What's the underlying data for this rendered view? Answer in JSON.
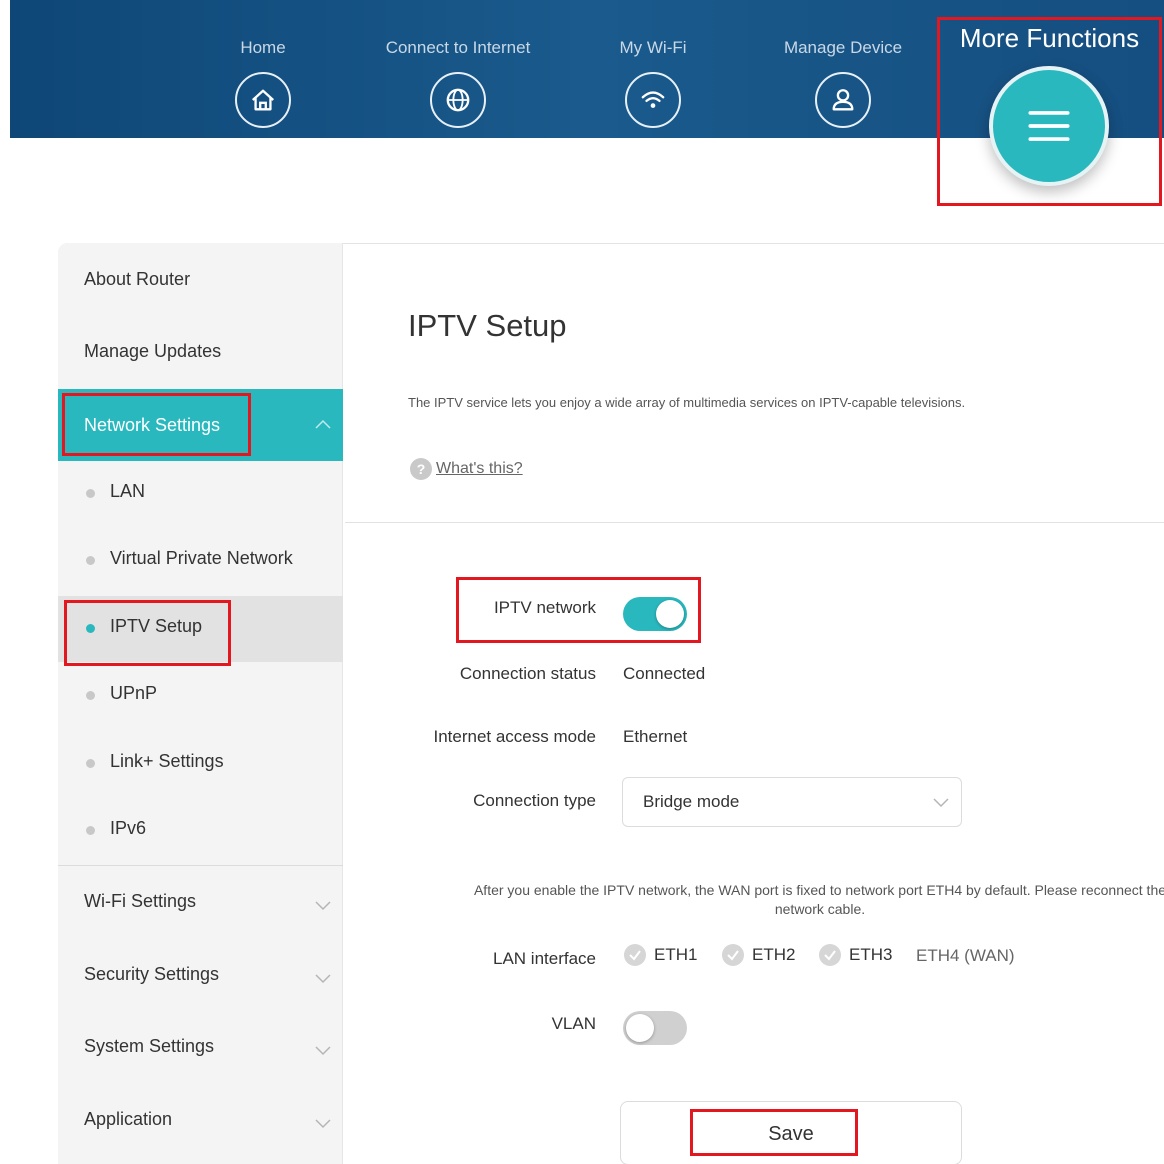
{
  "header": {
    "nav": [
      {
        "label": "Home",
        "icon": "home-icon"
      },
      {
        "label": "Connect to Internet",
        "icon": "globe-icon"
      },
      {
        "label": "My Wi-Fi",
        "icon": "wifi-icon"
      },
      {
        "label": "Manage Device",
        "icon": "user-icon"
      }
    ],
    "more_functions": {
      "label": "More Functions",
      "icon": "menu-icon"
    }
  },
  "sidebar": {
    "items": [
      {
        "label": "About Router"
      },
      {
        "label": "Manage Updates"
      }
    ],
    "network_settings": {
      "label": "Network Settings",
      "expanded": true,
      "sub_items": [
        {
          "label": "LAN",
          "active": false
        },
        {
          "label": "Virtual Private Network",
          "active": false
        },
        {
          "label": "IPTV Setup",
          "active": true
        },
        {
          "label": "UPnP",
          "active": false
        },
        {
          "label": "Link+ Settings",
          "active": false
        },
        {
          "label": "IPv6",
          "active": false
        }
      ]
    },
    "collapsed_groups": [
      {
        "label": "Wi-Fi Settings"
      },
      {
        "label": "Security Settings"
      },
      {
        "label": "System Settings"
      },
      {
        "label": "Application"
      }
    ]
  },
  "main": {
    "title": "IPTV Setup",
    "description": "The IPTV service lets you enjoy a wide array of multimedia services on IPTV-capable televisions.",
    "whats_this": "What's this?",
    "form": {
      "iptv_network_label": "IPTV network",
      "iptv_network_on": true,
      "connection_status_label": "Connection status",
      "connection_status_value": "Connected",
      "access_mode_label": "Internet access mode",
      "access_mode_value": "Ethernet",
      "connection_type_label": "Connection type",
      "connection_type_value": "Bridge mode",
      "note": "After you enable the IPTV network, the WAN port is fixed to network port ETH4 by default. Please reconnect the network cable.",
      "lan_interface_label": "LAN interface",
      "lan_ports": [
        "ETH1",
        "ETH2",
        "ETH3"
      ],
      "wan_port": "ETH4 (WAN)",
      "vlan_label": "VLAN",
      "vlan_on": false,
      "save_label": "Save"
    }
  },
  "colors": {
    "header_bg": "#154e80",
    "accent": "#2ab8bf",
    "highlight_box": "#e3171f"
  }
}
